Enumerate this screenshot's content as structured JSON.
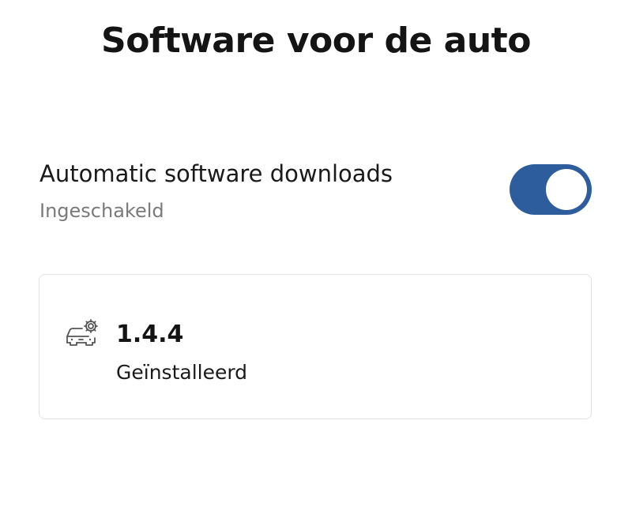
{
  "header": {
    "title": "Software voor de auto"
  },
  "auto_download": {
    "label": "Automatic software downloads",
    "status": "Ingeschakeld",
    "enabled": true,
    "accent_color": "#2d5d9c"
  },
  "software_card": {
    "icon": "car-settings-icon",
    "version": "1.4.4",
    "status": "Geïnstalleerd"
  }
}
